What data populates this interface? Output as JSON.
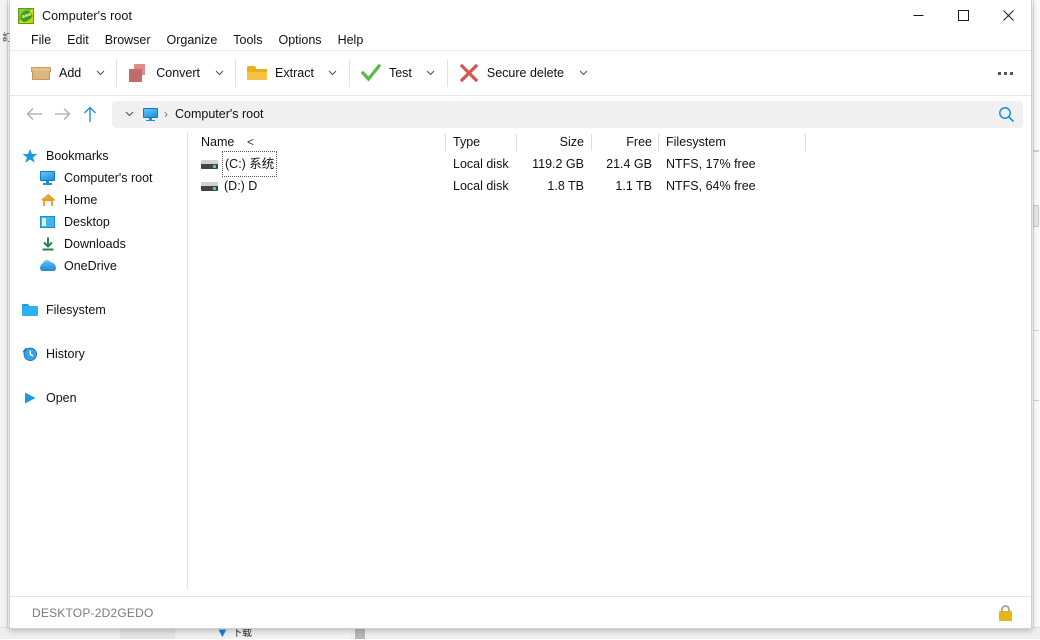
{
  "window": {
    "title": "Computer's root",
    "app_icon": "peazip-icon",
    "controls": {
      "minimize": "minimize-icon",
      "maximize": "maximize-icon",
      "close": "close-icon"
    }
  },
  "menubar": {
    "items": [
      {
        "label": "File"
      },
      {
        "label": "Edit"
      },
      {
        "label": "Browser"
      },
      {
        "label": "Organize"
      },
      {
        "label": "Tools"
      },
      {
        "label": "Options"
      },
      {
        "label": "Help"
      }
    ]
  },
  "toolbar": {
    "buttons": [
      {
        "label": "Add",
        "icon": "add-box-icon",
        "has_caret": true
      },
      {
        "label": "Convert",
        "icon": "convert-icon",
        "has_caret": true
      },
      {
        "label": "Extract",
        "icon": "extract-folder-icon",
        "has_caret": true
      },
      {
        "label": "Test",
        "icon": "test-check-icon",
        "has_caret": true
      },
      {
        "label": "Secure delete",
        "icon": "secure-delete-x-icon",
        "has_caret": true
      }
    ],
    "overflow": "overflow-menu-icon"
  },
  "addressbar": {
    "back": "back-arrow-icon",
    "forward": "forward-arrow-icon",
    "up": "up-arrow-icon",
    "history_caret": "chevron-down-icon",
    "crumb_icon": "computer-monitor-icon",
    "crumb_separator": "›",
    "path": "Computer's root",
    "search": "search-icon"
  },
  "sidebar": {
    "groups": [
      {
        "header": {
          "label": "Bookmarks",
          "icon": "star-icon"
        },
        "items": [
          {
            "label": "Computer's root",
            "icon": "computer-monitor-icon"
          },
          {
            "label": "Home",
            "icon": "home-icon"
          },
          {
            "label": "Desktop",
            "icon": "desktop-icon"
          },
          {
            "label": "Downloads",
            "icon": "download-icon"
          },
          {
            "label": "OneDrive",
            "icon": "onedrive-cloud-icon"
          }
        ]
      },
      {
        "header": {
          "label": "Filesystem",
          "icon": "folder-icon"
        },
        "items": []
      },
      {
        "header": {
          "label": "History",
          "icon": "history-clock-icon"
        },
        "items": []
      },
      {
        "header": {
          "label": "Open",
          "icon": "open-play-icon"
        },
        "items": []
      }
    ]
  },
  "filelist": {
    "columns": [
      {
        "key": "name",
        "label": "Name",
        "sort_glyph": "<"
      },
      {
        "key": "type",
        "label": "Type"
      },
      {
        "key": "size",
        "label": "Size"
      },
      {
        "key": "free",
        "label": "Free"
      },
      {
        "key": "filesystem",
        "label": "Filesystem"
      }
    ],
    "rows": [
      {
        "icon": "hard-drive-icon",
        "name": "(C:) 系统",
        "focused": true,
        "type": "Local disk",
        "size": "119.2 GB",
        "free": "21.4 GB",
        "filesystem": "NTFS, 17% free"
      },
      {
        "icon": "hard-drive-icon",
        "name": "(D:) D",
        "focused": false,
        "type": "Local disk",
        "size": "1.8 TB",
        "free": "1.1 TB",
        "filesystem": "NTFS, 64% free"
      }
    ]
  },
  "statusbar": {
    "text": "DESKTOP-2D2GEDO",
    "lock_icon": "unlocked-padlock-icon"
  },
  "background": {
    "taskbar_arrow": "up-triangle-icon",
    "taskbar_text": "下载"
  },
  "colors": {
    "accent_blue": "#1b8fe0",
    "test_green": "#57b947",
    "delete_red": "#d9534f",
    "extract_gold": "#f5c242",
    "add_tan": "#dcb77f",
    "convert_rose": "#c26b68",
    "lock_gold": "#e8b614",
    "status_gray": "#7a7a7a"
  }
}
